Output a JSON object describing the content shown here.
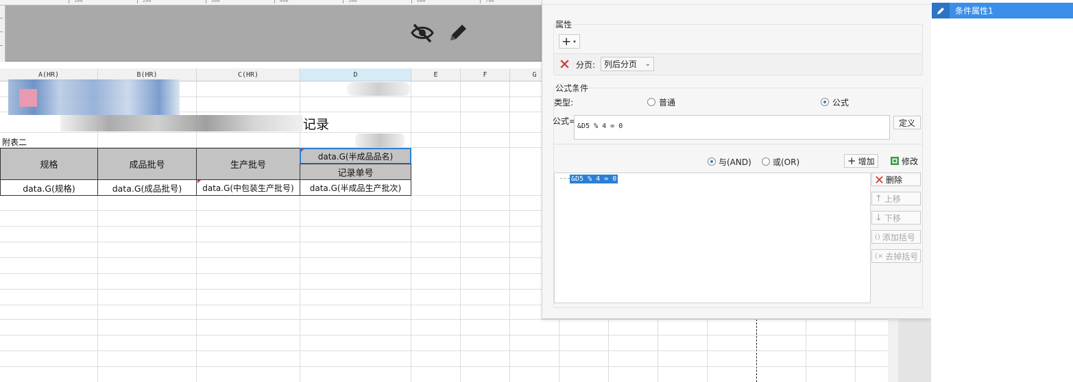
{
  "ruler": {
    "marks": [
      "100",
      "200",
      "300",
      "400",
      "500",
      "600",
      "700"
    ]
  },
  "preview": {
    "icons": [
      "eye-slash-icon",
      "pencil-icon"
    ]
  },
  "sheet": {
    "columns": [
      "A(HR)",
      "B(HR)",
      "C(HR)",
      "D",
      "E",
      "F",
      "G"
    ],
    "selected_column": "D",
    "title_fragment": "记录",
    "appendix": "附表二",
    "headers": [
      "规格",
      "成品批号",
      "生产批号"
    ],
    "d_header_top": "data.G(半成品品名)",
    "d_header_bottom": "记录单号",
    "data_row": [
      "data.G(规格)",
      "data.G(成品批号)",
      "data.G(中包装生产批号)",
      "data.G(半成品生产批次)"
    ]
  },
  "dialog": {
    "attr_section": "属性",
    "add_symbol": "+",
    "page_break_label": "分页:",
    "page_break_value": "列后分页",
    "formula_section": "公式条件",
    "type_label": "类型:",
    "type_options": [
      "普通",
      "公式"
    ],
    "type_selected": "公式",
    "formula_label": "公式=",
    "formula_value": "&D5 % 4 = 0",
    "define_button": "定义",
    "logic_options": [
      "与(AND)",
      "或(OR)"
    ],
    "logic_selected": "与(AND)",
    "add_button": "增加",
    "modify_button": "修改",
    "conditions": [
      "&D5 % 4 = 0"
    ],
    "side_buttons": {
      "delete": "删除",
      "move_up": "上移",
      "move_down": "下移",
      "add_bracket": "添加括号",
      "remove_bracket": "去掉括号"
    }
  },
  "list_panel": {
    "items": [
      "条件属性1"
    ]
  },
  "colors": {
    "accent": "#3b8fe8",
    "selection": "#2b7fd4",
    "delete_red": "#d43c3c"
  }
}
